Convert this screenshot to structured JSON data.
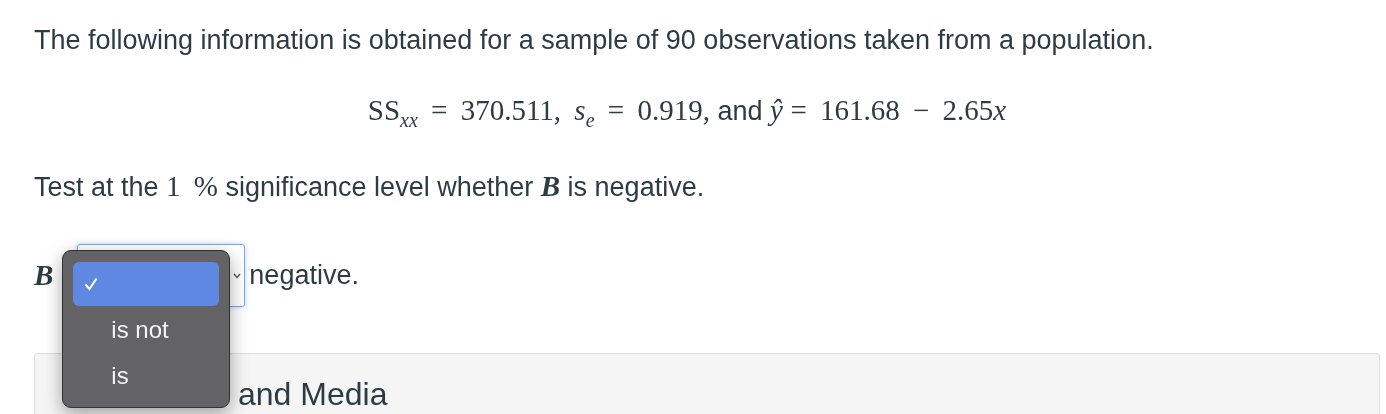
{
  "intro": "The following information is obtained for a sample of 90 observations taken from a population.",
  "formula": [
    {
      "kind": "math",
      "text": "SS$_{xx}$ = 370.511, *s*$_{e}$ = 0.919,"
    },
    {
      "kind": "text",
      "text": "and"
    },
    {
      "kind": "var",
      "text": "ŷ"
    },
    {
      "kind": "math",
      "text": "= 161.68 − 2.65"
    },
    {
      "kind": "var",
      "text": "x",
      "attached": true
    }
  ],
  "test_line": [
    {
      "kind": "text",
      "text": "Test at the"
    },
    {
      "kind": "math",
      "text": "1 %"
    },
    {
      "kind": "text",
      "text": "significance level whether"
    },
    {
      "kind": "mathbold",
      "text": "B"
    },
    {
      "kind": "text",
      "text": "is negative."
    }
  ],
  "answer": {
    "label": "B",
    "after": "negative.",
    "dropdown": {
      "expanded": true,
      "options": [
        {
          "selected": true
        },
        {
          "label": "is not",
          "selected": false
        },
        {
          "label": "is",
          "selected": false
        }
      ]
    }
  },
  "panel": {
    "title": "and Media"
  }
}
